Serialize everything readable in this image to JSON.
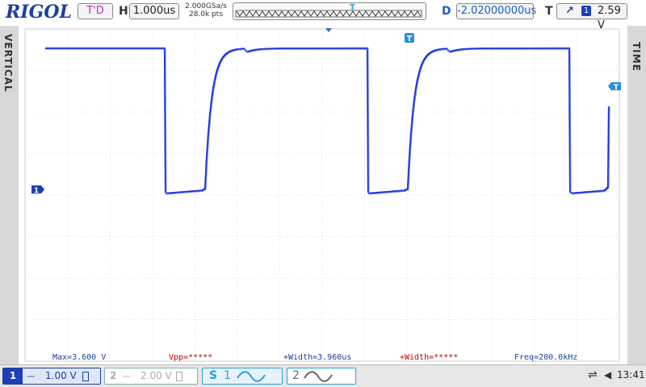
{
  "brand": "RIGOL",
  "status": "T'D",
  "horizontal": {
    "label": "H",
    "timebase": "1.000us",
    "sample_rate": "2.000GSa/s",
    "points": "28.0k pts"
  },
  "delay": {
    "label": "D",
    "value": "-2.02000000us"
  },
  "trigger": {
    "label": "T",
    "source": "1",
    "level": "2.59 V"
  },
  "tabs": {
    "left": "VERTICAL",
    "right": "TIME"
  },
  "markers": {
    "channel": "1",
    "trigger_pos": "T"
  },
  "measurements": {
    "max": "Max=3.600 V",
    "vpp": "Vpp=*****",
    "pos_width": "+Width=3.960us",
    "width2": "+Width=*****",
    "freq": "Freq=200.0kHz"
  },
  "channels": {
    "ch1": {
      "num": "1",
      "scale": "1.00 V"
    },
    "ch2": {
      "num": "2",
      "scale": "2.00 V"
    }
  },
  "math": {
    "m1_label": "S",
    "m1_num": "1",
    "m2_num": "2"
  },
  "clock": "13:41",
  "colors": {
    "trace": "#1b2fd8",
    "brand": "#1b3f9b",
    "accent": "#2aa1d8",
    "status": "#c12bd0",
    "measure": "#c00000"
  },
  "icons": {
    "usb": "usb-icon",
    "speaker": "speaker-icon"
  }
}
